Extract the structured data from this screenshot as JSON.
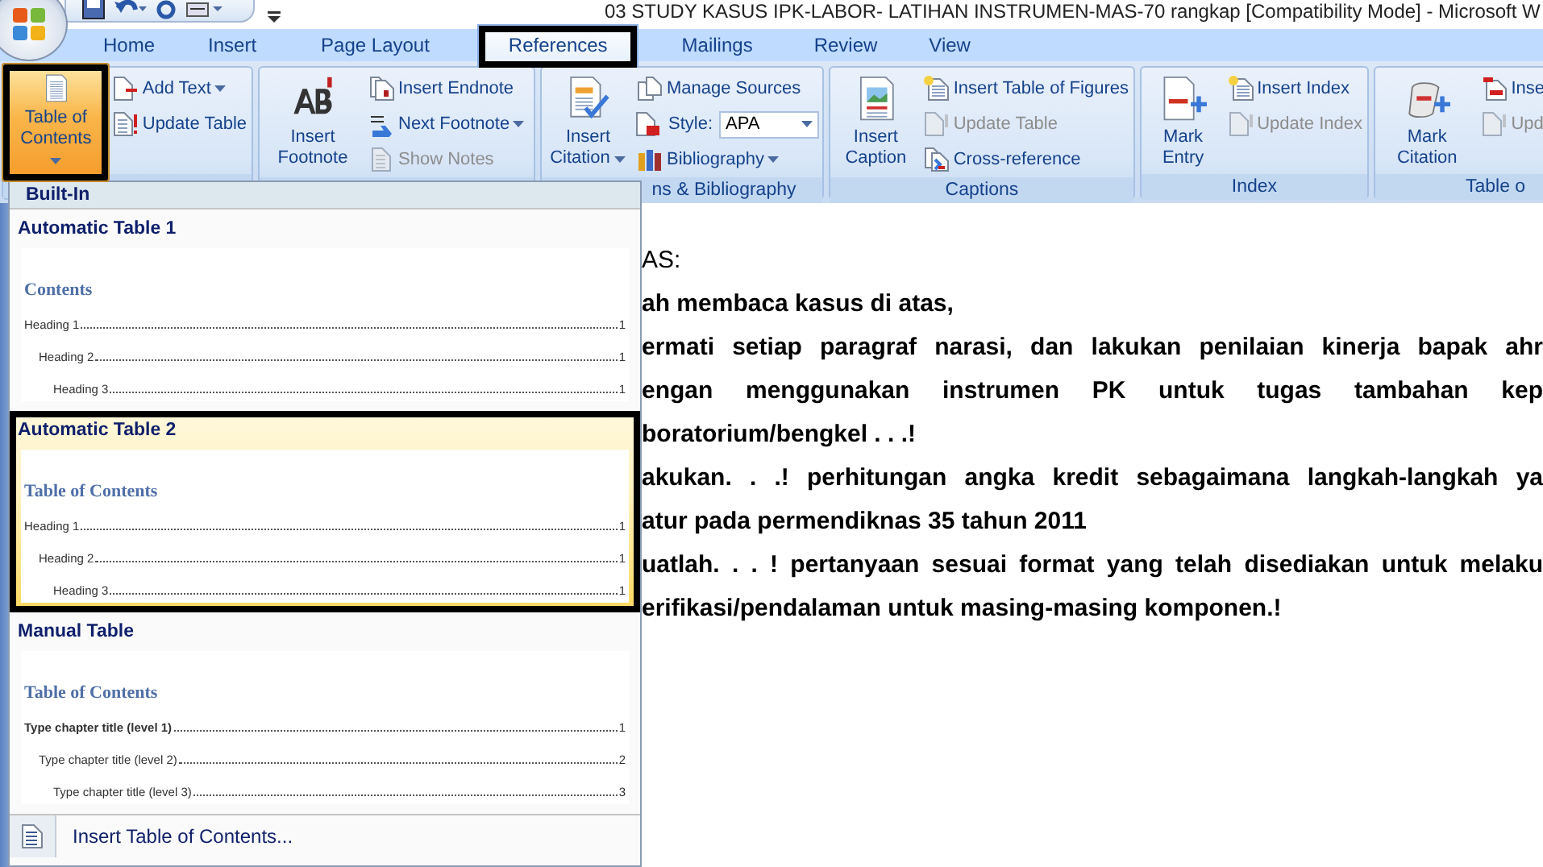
{
  "title_bar": {
    "title": "03 STUDY KASUS IPK-LABOR- LATIHAN INSTRUMEN-MAS-70 rangkap [Compatibility Mode] - Microsoft W"
  },
  "tabs": [
    {
      "label": "Home",
      "selected": false,
      "highlighted": false
    },
    {
      "label": "Insert",
      "selected": false,
      "highlighted": false
    },
    {
      "label": "Page Layout",
      "selected": false,
      "highlighted": false
    },
    {
      "label": "References",
      "selected": true,
      "highlighted": true
    },
    {
      "label": "Mailings",
      "selected": false,
      "highlighted": false
    },
    {
      "label": "Review",
      "selected": false,
      "highlighted": false
    },
    {
      "label": "View",
      "selected": false,
      "highlighted": false
    }
  ],
  "ribbon": {
    "groups": [
      {
        "items": [
          {
            "kind": "large",
            "label": "Table of Contents",
            "dropdown": true,
            "expanded": true,
            "highlighted": true
          },
          {
            "kind": "small",
            "label": "Add Text",
            "dropdown": true,
            "disabled": false
          },
          {
            "kind": "small",
            "label": "Update Table",
            "dropdown": false,
            "disabled": false
          }
        ]
      },
      {
        "items": [
          {
            "kind": "large",
            "label": "Insert Footnote",
            "dropdown": false,
            "expanded": false,
            "highlighted": false
          },
          {
            "kind": "small",
            "label": "Insert Endnote",
            "dropdown": false,
            "disabled": false
          },
          {
            "kind": "small",
            "label": "Next Footnote",
            "dropdown": true,
            "disabled": false
          },
          {
            "kind": "small",
            "label": "Show Notes",
            "dropdown": false,
            "disabled": true
          }
        ]
      },
      {
        "label": "ns & Bibliography",
        "items": [
          {
            "kind": "large",
            "label": "Insert Citation",
            "dropdown": true,
            "expanded": false,
            "highlighted": false
          },
          {
            "kind": "small",
            "label": "Manage Sources",
            "dropdown": false,
            "disabled": false
          },
          {
            "kind": "combo",
            "label": "Style:",
            "value": "APA"
          },
          {
            "kind": "small",
            "label": "Bibliography",
            "dropdown": true,
            "disabled": false
          }
        ]
      },
      {
        "label": "Captions",
        "items": [
          {
            "kind": "large",
            "label": "Insert Caption",
            "dropdown": false,
            "expanded": false,
            "highlighted": false
          },
          {
            "kind": "small",
            "label": "Insert Table of Figures",
            "dropdown": false,
            "disabled": false
          },
          {
            "kind": "small",
            "label": "Update Table",
            "dropdown": false,
            "disabled": true
          },
          {
            "kind": "small",
            "label": "Cross-reference",
            "dropdown": false,
            "disabled": false
          }
        ]
      },
      {
        "label": "Index",
        "items": [
          {
            "kind": "large",
            "label": "Mark Entry",
            "dropdown": false,
            "expanded": false,
            "highlighted": false
          },
          {
            "kind": "small",
            "label": "Insert Index",
            "dropdown": false,
            "disabled": false
          },
          {
            "kind": "small",
            "label": "Update Index",
            "dropdown": false,
            "disabled": true
          }
        ]
      },
      {
        "label": "Table o",
        "items": [
          {
            "kind": "large",
            "label": "Mark Citation",
            "dropdown": false,
            "expanded": false,
            "highlighted": false
          },
          {
            "kind": "small",
            "label": "Inse",
            "dropdown": false,
            "disabled": false
          },
          {
            "kind": "small",
            "label": "Upd",
            "dropdown": false,
            "disabled": true
          }
        ]
      }
    ]
  },
  "toc_menu": {
    "header": "Built-In",
    "galleries": [
      {
        "title": "Automatic Table 1",
        "selected": false,
        "highlighted": false,
        "preview": {
          "heading": "Contents",
          "entries": [
            {
              "text": "Heading 1",
              "page": "1",
              "bold": false,
              "children": [
                {
                  "text": "Heading 2",
                  "page": "1",
                  "bold": false,
                  "children": [
                    {
                      "text": "Heading 3",
                      "page": "1",
                      "bold": false
                    }
                  ]
                }
              ]
            }
          ]
        }
      },
      {
        "title": "Automatic Table 2",
        "selected": true,
        "highlighted": true,
        "preview": {
          "heading": "Table of Contents",
          "entries": [
            {
              "text": "Heading 1",
              "page": "1",
              "bold": false,
              "children": [
                {
                  "text": "Heading 2",
                  "page": "1",
                  "bold": false,
                  "children": [
                    {
                      "text": "Heading 3",
                      "page": "1",
                      "bold": false
                    }
                  ]
                }
              ]
            }
          ]
        }
      },
      {
        "title": "Manual Table",
        "selected": false,
        "highlighted": false,
        "preview": {
          "heading": "Table of Contents",
          "entries": [
            {
              "text": "Type chapter title (level 1)",
              "page": "1",
              "bold": true,
              "children": [
                {
                  "text": "Type chapter title (level 2)",
                  "page": "2",
                  "bold": false,
                  "children": [
                    {
                      "text": "Type chapter title (level 3)",
                      "page": "3",
                      "bold": false
                    }
                  ]
                }
              ]
            }
          ]
        }
      }
    ],
    "commands": [
      {
        "label": "Insert Table of Contents..."
      }
    ]
  },
  "document": {
    "lines": [
      {
        "text": "AS:",
        "bold": false,
        "justified": false
      },
      {
        "text": "ah membaca kasus di atas,",
        "bold": true,
        "justified": false
      },
      {
        "text": "ermati setiap paragraf narasi, dan lakukan penilaian kinerja bapak ahr",
        "bold": true,
        "justified": true
      },
      {
        "text": "engan menggunakan instrumen PK untuk tugas tambahan kep",
        "bold": true,
        "justified": true
      },
      {
        "text": "boratorium/bengkel . . .!",
        "bold": true,
        "justified": false
      },
      {
        "text": "akukan. . .! perhitungan angka kredit sebagaimana langkah-langkah ya",
        "bold": true,
        "justified": true
      },
      {
        "text": "atur pada permendiknas 35 tahun 2011",
        "bold": true,
        "justified": false
      },
      {
        "text": "uatlah. . . ! pertanyaan sesuai format yang telah disediakan untuk melaku",
        "bold": true,
        "justified": true
      },
      {
        "text": "erifikasi/pendalaman untuk masing-masing komponen.!",
        "bold": true,
        "justified": false
      }
    ]
  }
}
